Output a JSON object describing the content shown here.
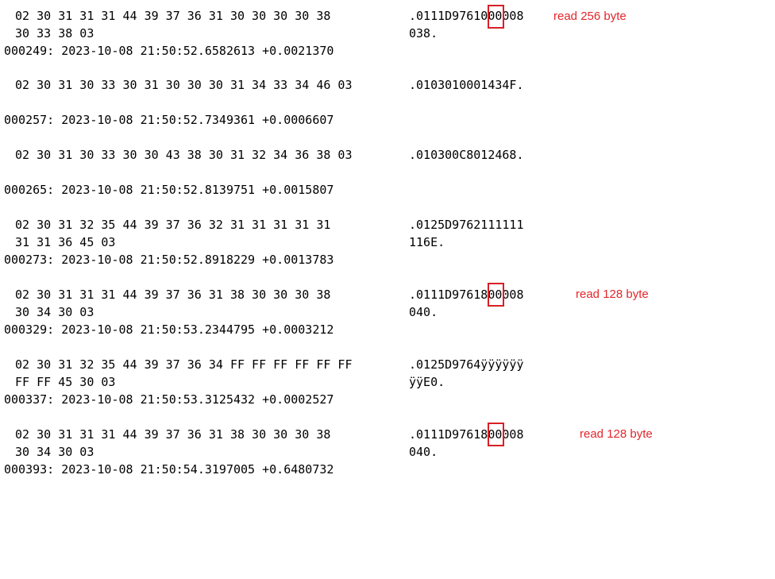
{
  "log_entries": [
    {
      "hex_lines": [
        " 02 30 31 31 31 44 39 37 36 31 30 30 30 30 38",
        " 30 33 38 03"
      ],
      "ascii_lines": [
        ".0111D9761000008",
        "038."
      ],
      "timestamp": "000249: 2023-10-08 21:50:52.6582613 +0.0021370",
      "note": "read 256 byte"
    },
    {
      "hex_lines": [
        " 02 30 31 30 33 30 31 30 30 30 31 34 33 34 46 03"
      ],
      "ascii_lines": [
        ".0103010001434F."
      ],
      "timestamp": "000257: 2023-10-08 21:50:52.7349361 +0.0006607"
    },
    {
      "hex_lines": [
        " 02 30 31 30 33 30 30 43 38 30 31 32 34 36 38 03"
      ],
      "ascii_lines": [
        ".010300C8012468."
      ],
      "timestamp": "000265: 2023-10-08 21:50:52.8139751 +0.0015807"
    },
    {
      "hex_lines": [
        " 02 30 31 32 35 44 39 37 36 32 31 31 31 31 31",
        " 31 31 36 45 03"
      ],
      "ascii_lines": [
        ".0125D9762111111",
        "116E."
      ],
      "timestamp": "000273: 2023-10-08 21:50:52.8918229 +0.0013783"
    },
    {
      "hex_lines": [
        " 02 30 31 31 31 44 39 37 36 31 38 30 30 30 38",
        " 30 34 30 03"
      ],
      "ascii_lines": [
        ".0111D9761800008",
        "040."
      ],
      "timestamp": "000329: 2023-10-08 21:50:53.2344795 +0.0003212",
      "note": "read 128 byte"
    },
    {
      "hex_lines": [
        " 02 30 31 32 35 44 39 37 36 34 FF FF FF FF FF FF",
        " FF FF 45 30 03"
      ],
      "ascii_lines": [
        ".0125D9764ÿÿÿÿÿÿ",
        "ÿÿE0."
      ],
      "timestamp": "000337: 2023-10-08 21:50:53.3125432 +0.0002527"
    },
    {
      "hex_lines": [
        " 02 30 31 31 31 44 39 37 36 31 38 30 30 30 38",
        " 30 34 30 03"
      ],
      "ascii_lines": [
        ".0111D9761800008",
        "040."
      ],
      "timestamp": "000393: 2023-10-08 21:50:54.3197005 +0.6480732",
      "note": "read 128 byte"
    }
  ],
  "colors": {
    "text": "#000000",
    "annotation": "#e3262b",
    "highlight_box": "#d91f26"
  }
}
